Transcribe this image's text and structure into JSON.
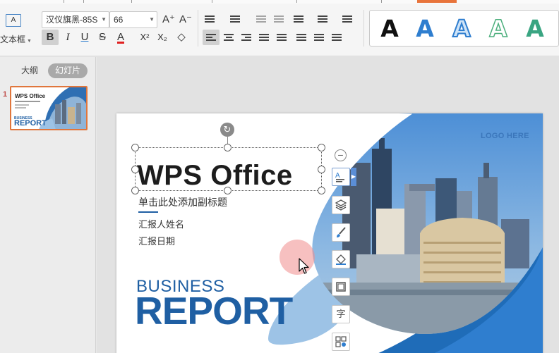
{
  "toolbar": {
    "textbox_icon_text": "A",
    "textbox_label": "文本框",
    "font_name": "汉仪旗黑-85S",
    "font_size": "66",
    "grow_font": "A⁺",
    "shrink_font": "A⁻",
    "bold": "B",
    "italic": "I",
    "underline": "U",
    "strike": "S",
    "font_color": "A",
    "superscript": "X²",
    "subscript": "X₂",
    "clear_format": "◇",
    "accent_color": "#2f7ecf",
    "highlight_color": "#e8743b"
  },
  "gallery": {
    "styles": [
      "A",
      "A",
      "A",
      "A",
      "A"
    ]
  },
  "pane": {
    "tab_outline": "大纲",
    "tab_slides": "幻灯片",
    "slide_number": "1",
    "thumb_title": "WPS Office",
    "thumb_biz": "BUSINESS",
    "thumb_report": "REPORT"
  },
  "slide": {
    "title": "WPS Office",
    "subtitle_placeholder": "单击此处添加副标题",
    "reporter": "汇报人姓名",
    "date": "汇报日期",
    "logo": "LOGO HERE",
    "business": "BUSINESS",
    "report": "REPORT",
    "brand_blue": "#1f5fa3",
    "light_blue": "#9dc3e6"
  },
  "float_tools": {
    "collapse": "−",
    "tools": [
      "text-style-icon",
      "layers-icon",
      "brush-icon",
      "fill-icon",
      "border-icon",
      "font-icon",
      "effects-icon"
    ],
    "font_tool_char": "字"
  }
}
